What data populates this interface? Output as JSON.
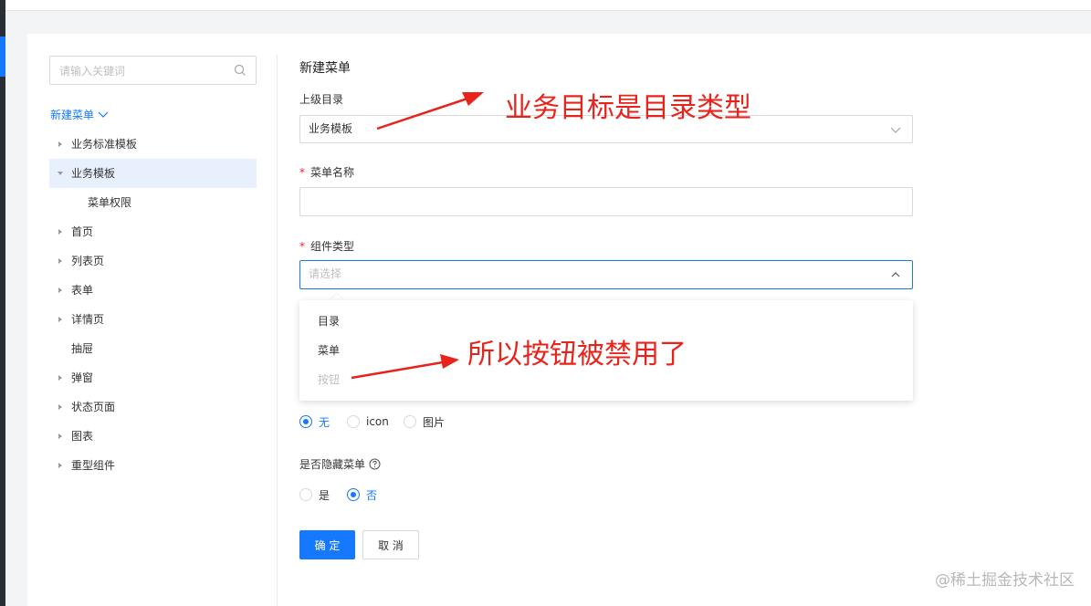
{
  "sidebar": {
    "search_placeholder": "请输入关键词",
    "root_label": "新建菜单",
    "items": [
      {
        "label": "业务标准模板"
      },
      {
        "label": "业务模板"
      },
      {
        "label": "菜单权限"
      },
      {
        "label": "首页"
      },
      {
        "label": "列表页"
      },
      {
        "label": "表单"
      },
      {
        "label": "详情页"
      },
      {
        "label": "抽屉"
      },
      {
        "label": "弹窗"
      },
      {
        "label": "状态页面"
      },
      {
        "label": "图表"
      },
      {
        "label": "重型组件"
      }
    ],
    "selected": "业务模板"
  },
  "form": {
    "title": "新建菜单",
    "parent_dir": {
      "label": "上级目录",
      "value": "业务模板"
    },
    "menu_name": {
      "label": "菜单名称",
      "value": ""
    },
    "component_type": {
      "label": "组件类型",
      "placeholder": "请选择"
    },
    "dropdown_options": [
      {
        "label": "目录",
        "disabled": false
      },
      {
        "label": "菜单",
        "disabled": false
      },
      {
        "label": "按钮",
        "disabled": true
      }
    ],
    "icon_type_options": [
      "无",
      "icon",
      "图片"
    ],
    "icon_type_selected": "无",
    "hide_menu": {
      "label": "是否隐藏菜单",
      "options": [
        "是",
        "否"
      ],
      "selected": "否"
    },
    "ok_label": "确 定",
    "cancel_label": "取 消"
  },
  "annotations": {
    "top": "业务目标是目录类型",
    "bottom": "所以按钮被禁用了"
  },
  "watermark": "@稀土掘金技术社区",
  "colors": {
    "accent": "#1677ff",
    "required": "#f5222d",
    "annotation": "#e8231b",
    "selected_bg": "#e8f0fd"
  }
}
